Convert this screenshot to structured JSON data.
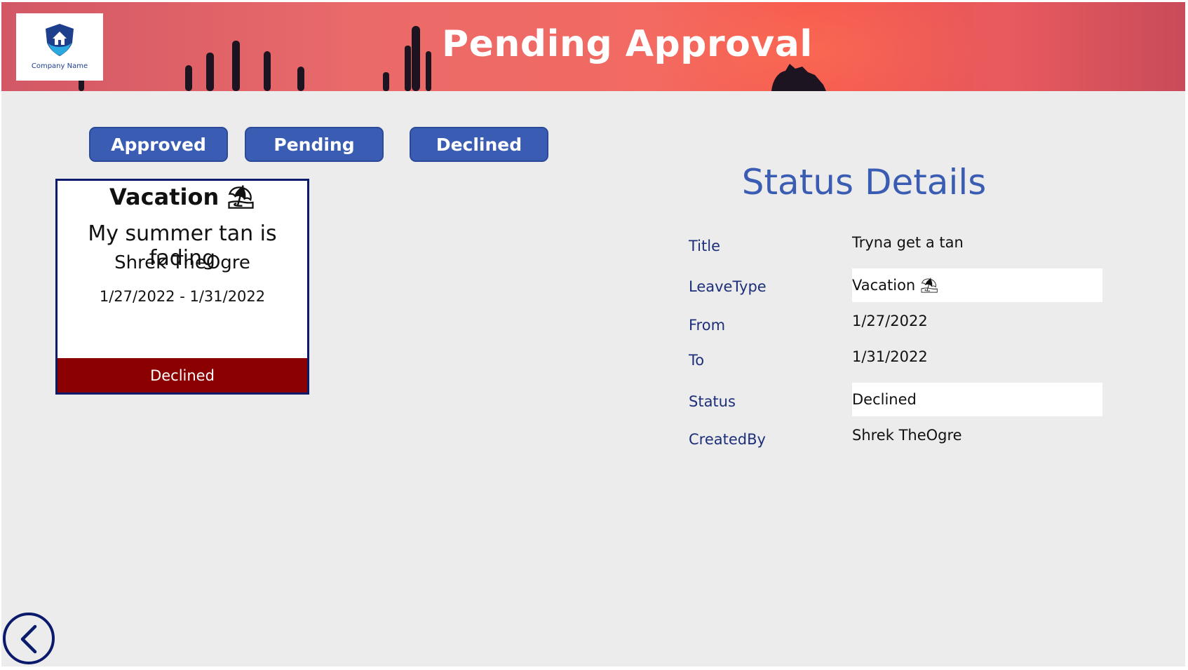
{
  "header": {
    "title": "Pending Approval",
    "logo_text": "Company Name",
    "logo_icon": "house-shield-icon"
  },
  "filters": [
    {
      "label": "Approved"
    },
    {
      "label": "Pending"
    },
    {
      "label": "Declined"
    }
  ],
  "card": {
    "leave_type": "Vacation ⛱",
    "title": "My summer tan is fading",
    "author": "Shrek TheOgre",
    "dates": "1/27/2022 - 1/31/2022",
    "status": "Declined",
    "status_color": "#8b0000"
  },
  "details": {
    "heading": "Status Details",
    "fields": [
      {
        "label": "Title",
        "value": "Tryna get a tan"
      },
      {
        "label": "LeaveType",
        "value": "Vacation ⛱"
      },
      {
        "label": "From",
        "value": "1/27/2022"
      },
      {
        "label": "To",
        "value": "1/31/2022"
      },
      {
        "label": "Status",
        "value": "Declined"
      },
      {
        "label": "CreatedBy",
        "value": "Shrek TheOgre"
      }
    ]
  },
  "nav": {
    "back_icon": "chevron-left-icon"
  },
  "colors": {
    "accent": "#3a5db3",
    "navy": "#0b1a6b",
    "declined": "#8b0000"
  }
}
